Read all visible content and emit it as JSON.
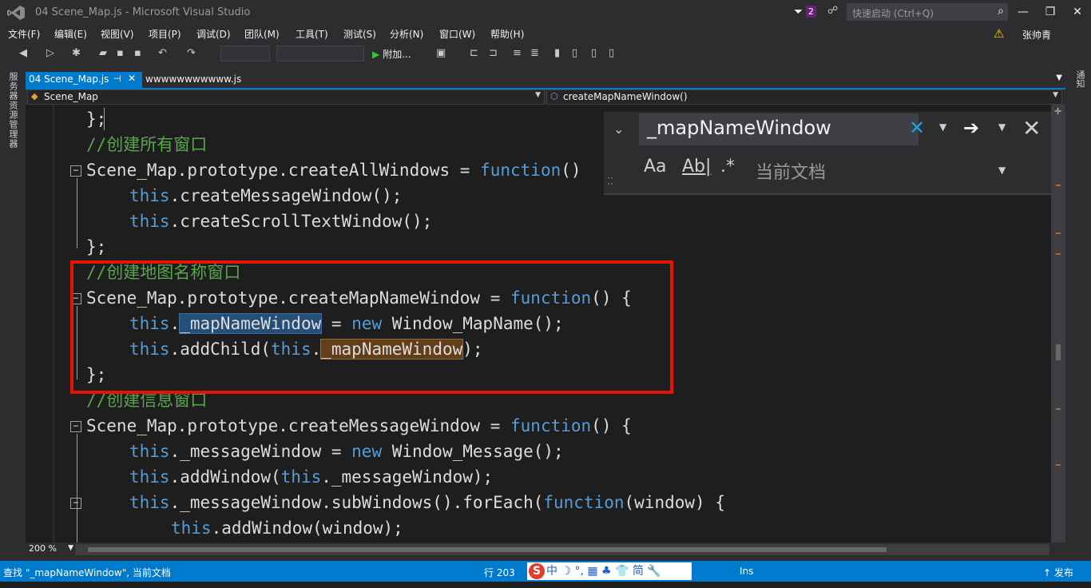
{
  "titlebar": {
    "title": "04 Scene_Map.js - Microsoft Visual Studio",
    "notification_count": "2",
    "quicklaunch_placeholder": "快速启动 (Ctrl+Q)",
    "user": "张帅青"
  },
  "menu": [
    "文件(F)",
    "编辑(E)",
    "视图(V)",
    "项目(P)",
    "调试(D)",
    "团队(M)",
    "工具(T)",
    "测试(S)",
    "分析(N)",
    "窗口(W)",
    "帮助(H)"
  ],
  "toolbar": {
    "attach_label": "附加..."
  },
  "sidebar_left": {
    "tab": "服务器资源管理器"
  },
  "sidebar_right": {
    "tab": "通知"
  },
  "tabs": [
    {
      "label": "04 Scene_Map.js",
      "active": true
    },
    {
      "label": "wwwwwwwwwww.js",
      "active": false
    }
  ],
  "navbar": {
    "scope": "Scene_Map",
    "member": "createMapNameWindow()"
  },
  "find": {
    "query": "_mapNameWindow",
    "options": [
      "Aa",
      "Ab|",
      ".*"
    ],
    "scope": "当前文档"
  },
  "code": {
    "l0": "};",
    "l1": "//创建所有窗口",
    "l2a": "Scene_Map.prototype.createAllWindows = ",
    "l2b": "function",
    "l2c": "()",
    "l3a": "this",
    "l3b": ".createMessageWindow();",
    "l4a": "this",
    "l4b": ".createScrollTextWindow();",
    "l5": "};",
    "l6": "//创建地图名称窗口",
    "l7a": "Scene_Map.prototype.createMapNameWindow = ",
    "l7b": "function",
    "l7c": "() {",
    "l8a": "this",
    "l8b": ".",
    "l8c": "_mapNameWindow",
    "l8d": " = ",
    "l8e": "new",
    "l8f": " Window_MapName();",
    "l9a": "this",
    "l9b": ".addChild(",
    "l9c": "this",
    "l9d": ".",
    "l9e": "_mapNameWindow",
    "l9f": ");",
    "l10": "};",
    "l11": "//创建信息窗口",
    "l12a": "Scene_Map.prototype.createMessageWindow = ",
    "l12b": "function",
    "l12c": "() {",
    "l13a": "this",
    "l13b": "._messageWindow = ",
    "l13c": "new",
    "l13d": " Window_Message();",
    "l14a": "this",
    "l14b": ".addWindow(",
    "l14c": "this",
    "l14d": "._messageWindow);",
    "l15a": "this",
    "l15b": "._messageWindow.subWindows().forEach(",
    "l15c": "function",
    "l15d": "(window) {",
    "l16a": "this",
    "l16b": ".addWindow(window);"
  },
  "editor": {
    "zoom": "200 %"
  },
  "status": {
    "find_text": "查找 \"_mapNameWindow\", 当前文档",
    "line": "行 203",
    "ime": "中 ☽ °, ▦ ♣ 👕 简 🔧",
    "ins": "Ins",
    "publish": "↑ 发布"
  },
  "colors": {
    "accent": "#007acc",
    "highlight_box": "#e51400",
    "keyword": "#569cd6",
    "comment": "#57a64a"
  }
}
